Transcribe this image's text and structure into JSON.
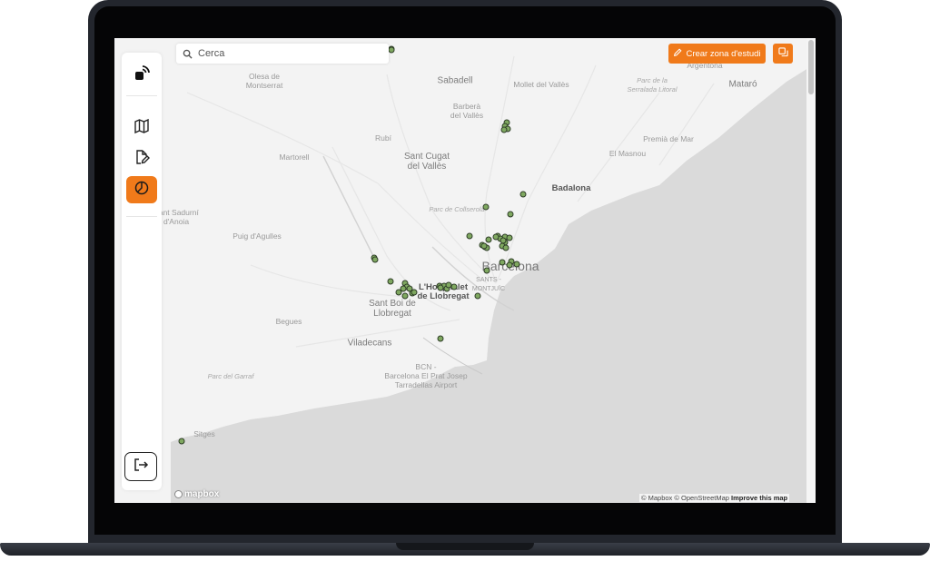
{
  "search": {
    "placeholder": "Cerca",
    "icon": "search-icon"
  },
  "toolbar": {
    "create_zone_label": "Crear zona d'estudi",
    "create_zone_icon": "pencil-icon",
    "layers_icon": "layers-icon"
  },
  "sidebar": {
    "logo_icon": "app-logo-icon",
    "items": [
      {
        "name": "map",
        "icon": "map-icon",
        "active": false
      },
      {
        "name": "edit-document",
        "icon": "edit-document-icon",
        "active": false
      },
      {
        "name": "analytics",
        "icon": "pie-chart-icon",
        "active": true
      }
    ],
    "logout_icon": "logout-icon"
  },
  "map": {
    "labels": [
      {
        "text": "Sabadell",
        "kind": "city"
      },
      {
        "text": "Mollet del Vallès",
        "kind": "town"
      },
      {
        "text": "Argentona",
        "kind": "town"
      },
      {
        "text": "Olesa de\nMontserrat",
        "kind": "town"
      },
      {
        "text": "Barberà\ndel Vallès",
        "kind": "town"
      },
      {
        "text": "Parc de la\nSerralada Litoral",
        "kind": "park"
      },
      {
        "text": "Mataró",
        "kind": "city"
      },
      {
        "text": "Rubí",
        "kind": "town"
      },
      {
        "text": "Sant Cugat\ndel Vallès",
        "kind": "city"
      },
      {
        "text": "Premià de Mar",
        "kind": "town"
      },
      {
        "text": "Martorell",
        "kind": "town"
      },
      {
        "text": "El Masnou",
        "kind": "town"
      },
      {
        "text": "Badalona",
        "kind": "bold"
      },
      {
        "text": "Parc de Collserola",
        "kind": "park"
      },
      {
        "text": "Sant Sadurní\nd'Anoia",
        "kind": "town"
      },
      {
        "text": "Puig d'Agulles",
        "kind": "town"
      },
      {
        "text": "Barcelona",
        "kind": "major"
      },
      {
        "text": "L'Hospitalet\nde Llobregat",
        "kind": "bold"
      },
      {
        "text": "SANTS -\nMONTJUÏC",
        "kind": "town"
      },
      {
        "text": "Sant Boi de\nLlobregat",
        "kind": "city"
      },
      {
        "text": "Begues",
        "kind": "town"
      },
      {
        "text": "Viladecans",
        "kind": "city"
      },
      {
        "text": "BCN -\nBarcelona El Prat Josep\nTarradellas Airport",
        "kind": "town"
      },
      {
        "text": "Parc del Garraf",
        "kind": "park"
      },
      {
        "text": "Sitges",
        "kind": "town"
      }
    ],
    "marker_color": "#7fa860",
    "marker_count": 60
  },
  "attribution": {
    "mapbox_logo": "mapbox",
    "text": "© Mapbox © OpenStreetMap",
    "improve": "Improve this map"
  },
  "colors": {
    "accent": "#f07a1a",
    "sea": "#dadada",
    "land": "#f3f3f3"
  }
}
